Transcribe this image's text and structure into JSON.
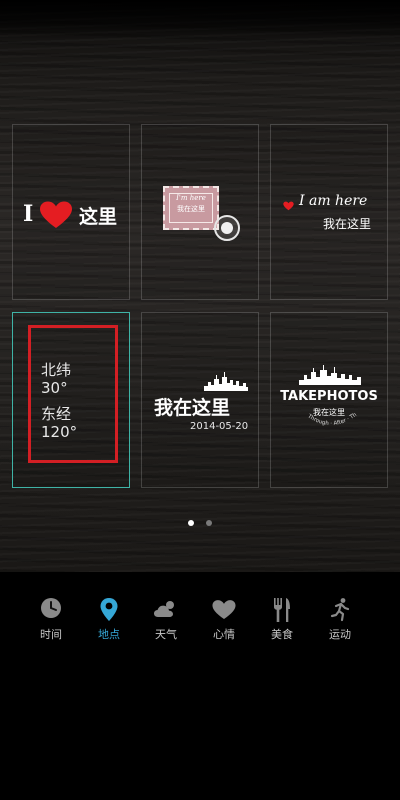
{
  "tiles": {
    "t1": {
      "i": "I",
      "text": "这里"
    },
    "t2": {
      "stamp_line1": "I'm here",
      "stamp_line2": "我在这里"
    },
    "t3": {
      "eng": "I am here",
      "chn": "我在这里"
    },
    "t4": {
      "lat_label": "北纬",
      "lat_value": "30°",
      "lon_label": "东经",
      "lon_value": "120°"
    },
    "t5": {
      "text": "我在这里",
      "date": "2014-05-20"
    },
    "t6": {
      "title": "TAKEPHOTOS",
      "sub": "我在这里",
      "arc": "Through · After · There"
    }
  },
  "pager": {
    "count": 2,
    "active": 0
  },
  "tabs": [
    {
      "label": "时间",
      "icon": "clock-icon",
      "active": false
    },
    {
      "label": "地点",
      "icon": "location-pin-icon",
      "active": true
    },
    {
      "label": "天气",
      "icon": "weather-icon",
      "active": false
    },
    {
      "label": "心情",
      "icon": "heart-icon",
      "active": false
    },
    {
      "label": "美食",
      "icon": "fork-knife-icon",
      "active": false
    },
    {
      "label": "运动",
      "icon": "running-icon",
      "active": false
    }
  ],
  "colors": {
    "accent": "#35a7d6",
    "selected_border": "#3fb3a6",
    "red_frame": "#d31f24",
    "heart": "#e51d22"
  }
}
